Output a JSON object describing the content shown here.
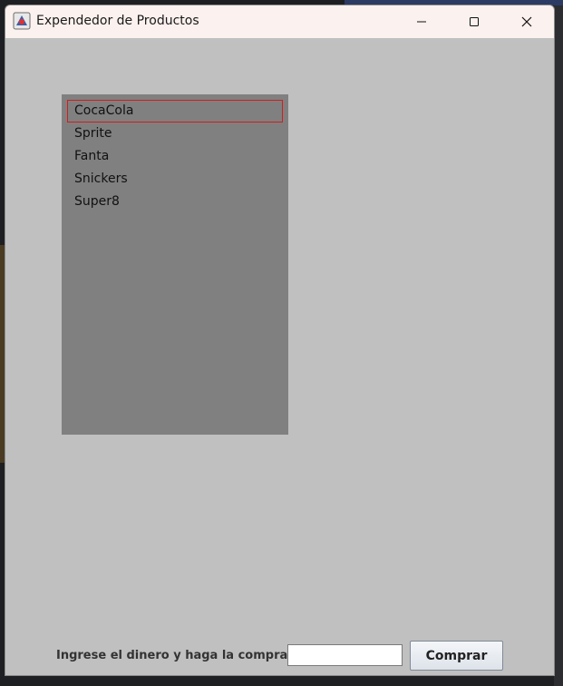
{
  "window": {
    "title": "Expendedor de Productos",
    "icons": {
      "app": "java-app-icon",
      "minimize": "minimize-icon",
      "maximize": "maximize-icon",
      "close": "close-icon"
    }
  },
  "products": {
    "items": [
      "CocaCola",
      "Sprite",
      "Fanta",
      "Snickers",
      "Super8"
    ],
    "selected_index": 0
  },
  "purchase": {
    "label": "Ingrese el dinero y haga la compra:",
    "input_value": "",
    "button_label": "Comprar"
  },
  "colors": {
    "window_bg": "#c0c0c0",
    "list_bg": "#808080",
    "selection_border": "#d21e1e",
    "titlebar_bg": "#fbf1ee"
  }
}
